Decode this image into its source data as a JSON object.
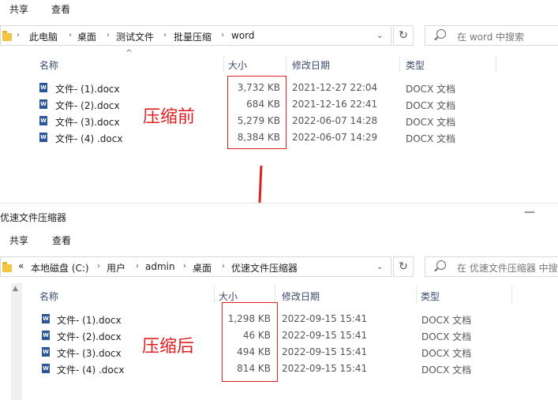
{
  "top": {
    "menu": [
      "共享",
      "查看"
    ],
    "address": [
      "此电脑",
      "桌面",
      "测试文件",
      "批量压缩",
      "word"
    ],
    "search_placeholder": "在 word 中搜索",
    "columns": {
      "name": "名称",
      "size": "大小",
      "modified": "修改日期",
      "type": "类型"
    },
    "files": [
      {
        "name": "文件- (1).docx",
        "size": "3,732 KB",
        "date": "2021-12-27 22:04",
        "type": "DOCX 文档"
      },
      {
        "name": "文件- (2).docx",
        "size": "684 KB",
        "date": "2021-12-16 22:41",
        "type": "DOCX 文档"
      },
      {
        "name": "文件- (3).docx",
        "size": "5,279 KB",
        "date": "2022-06-07 14:28",
        "type": "DOCX 文档"
      },
      {
        "name": "文件- (4) .docx",
        "size": "8,384 KB",
        "date": "2022-06-07 14:29",
        "type": "DOCX 文档"
      }
    ],
    "annotation": "压缩前"
  },
  "bottom": {
    "title": "优速文件压缩器",
    "minimize": "—",
    "menu": [
      "共享",
      "查看"
    ],
    "address_prefix": "«",
    "address": [
      "本地磁盘 (C:)",
      "用户",
      "admin",
      "桌面",
      "优速文件压缩器"
    ],
    "search_placeholder": "在 优速文件压缩器 中搜",
    "columns": {
      "name": "名称",
      "size": "大小",
      "modified": "修改日期",
      "type": "类型"
    },
    "files": [
      {
        "name": "文件- (1).docx",
        "size": "1,298 KB",
        "date": "2022-09-15 15:41",
        "type": "DOCX 文档"
      },
      {
        "name": "文件- (2).docx",
        "size": "46 KB",
        "date": "2022-09-15 15:41",
        "type": "DOCX 文档"
      },
      {
        "name": "文件- (3).docx",
        "size": "494 KB",
        "date": "2022-09-15 15:41",
        "type": "DOCX 文档"
      },
      {
        "name": "文件- (4) .docx",
        "size": "814 KB",
        "date": "2022-09-15 15:41",
        "type": "DOCX 文档"
      }
    ],
    "annotation": "压缩后"
  },
  "colors": {
    "annotation_red": "#e02020",
    "word_blue": "#2b579a",
    "folder_yellow": "#f5c542"
  }
}
